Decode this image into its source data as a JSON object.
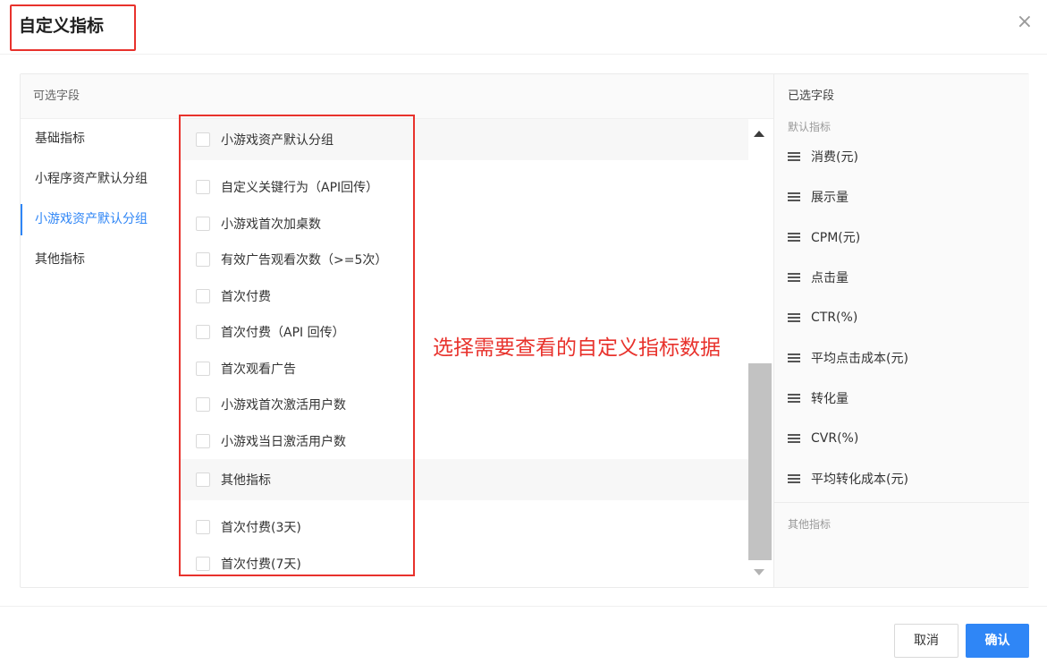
{
  "dialog": {
    "title": "自定义指标",
    "close_icon": "close-icon"
  },
  "available": {
    "header": "可选字段",
    "categories": [
      {
        "label": "基础指标",
        "active": false
      },
      {
        "label": "小程序资产默认分组",
        "active": false
      },
      {
        "label": "小游戏资产默认分组",
        "active": true
      },
      {
        "label": "其他指标",
        "active": false
      }
    ],
    "groups": [
      {
        "label": "小游戏资产默认分组",
        "items": [
          "自定义关键行为（API回传）",
          "小游戏首次加桌数",
          "有效广告观看次数（>=5次）",
          "首次付费",
          "首次付费（API 回传）",
          "首次观看广告",
          "小游戏首次激活用户数",
          "小游戏当日激活用户数"
        ]
      },
      {
        "label": "其他指标",
        "items": [
          "首次付费(3天)",
          "首次付费(7天)"
        ]
      }
    ]
  },
  "annotation": {
    "note": "选择需要查看的自定义指标数据",
    "color": "#e8322c"
  },
  "selected": {
    "header": "已选字段",
    "default_label": "默认指标",
    "items": [
      "消费(元)",
      "展示量",
      "CPM(元)",
      "点击量",
      "CTR(%)",
      "平均点击成本(元)",
      "转化量",
      "CVR(%)",
      "平均转化成本(元)"
    ],
    "other_label": "其他指标"
  },
  "footer": {
    "cancel_label": "取消",
    "ok_label": "确认"
  },
  "colors": {
    "accent": "#2f86f6",
    "highlight": "#e8322c"
  }
}
